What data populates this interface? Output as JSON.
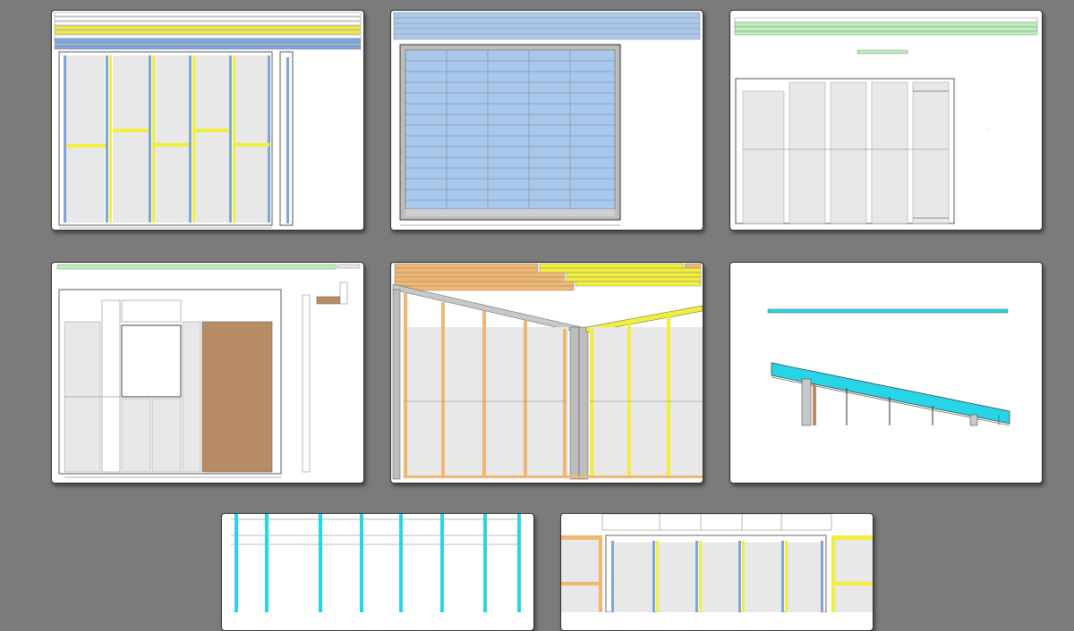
{
  "window": {
    "background": "#7b7b7b"
  },
  "pages": [
    {
      "id": "wall-framing-front",
      "label": ""
    },
    {
      "id": "roof-panel-plan",
      "label": ""
    },
    {
      "id": "wall-framing-side",
      "label": ""
    },
    {
      "id": "wall-openings-cladding",
      "label": ""
    },
    {
      "id": "gable-walls",
      "label": ""
    },
    {
      "id": "roof-section",
      "label": ""
    },
    {
      "id": "floor-joist-layout",
      "label": ""
    },
    {
      "id": "wall-framing-detail",
      "label": ""
    }
  ],
  "colors": {
    "stud_blue": "#7fa6d9",
    "stud_yellow": "#f2ef3a",
    "stud_orange": "#f0b770",
    "cyan": "#27d6e6",
    "green": "#b8f0b8",
    "cladding_brown": "#b88d66",
    "panel_gray": "#e8e8e8"
  }
}
